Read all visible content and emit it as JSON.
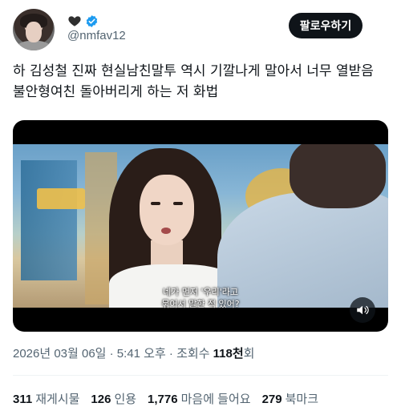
{
  "author": {
    "icon_heart": "black-heart-icon",
    "icon_verified": "verified-badge-icon",
    "handle": "@nmfav12",
    "verified_color": "#1d9bf0"
  },
  "follow_button": {
    "label": "팔로우하기"
  },
  "tweet": {
    "text": "하 김성철 진짜 현실남친말투 역시 기깔나게 말아서 너무 열받음 불안형여친 돌아버리게 하는 저 화법"
  },
  "media": {
    "subtitle_line1": "네가 먼저 '우리'라고",
    "subtitle_line2": "묶어서 말한 적 있어?"
  },
  "meta": {
    "datetime": "2026년 03월 06일 · 5:41 오후 · 조회수 ",
    "views": "118천",
    "views_suffix": "회"
  },
  "stats": {
    "retweets_count": "311",
    "retweets_label": "재게시물",
    "quotes_count": "126",
    "quotes_label": "인용",
    "likes_count": "1,776",
    "likes_label": "마음에 들어요",
    "bookmarks_count": "279",
    "bookmarks_label": "북마크"
  }
}
